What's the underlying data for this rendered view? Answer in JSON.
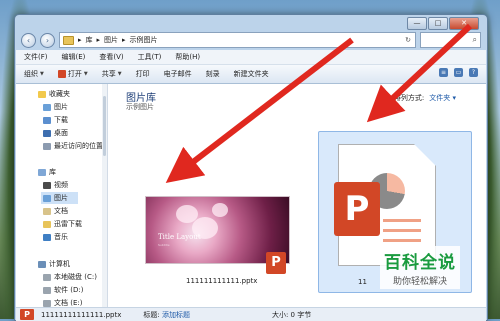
{
  "window": {
    "caption": {
      "minimize": "—",
      "maximize": "□",
      "close": "✕"
    }
  },
  "address": {
    "crumb1": "库",
    "crumb2": "图片",
    "crumb3": "示例图片",
    "refresh": "↻",
    "search_icon": "search-icon"
  },
  "menubar": {
    "items": [
      "文件(F)",
      "编辑(E)",
      "查看(V)",
      "工具(T)",
      "帮助(H)"
    ]
  },
  "toolbar": {
    "organize": "组织",
    "open": "打开",
    "share": "共享",
    "print": "打印",
    "email": "电子邮件",
    "burn": "刻录",
    "new_folder": "新建文件夹"
  },
  "sidebar": {
    "favorites": "收藏夹",
    "fav_items": [
      "图片",
      "下载",
      "桌面",
      "最近访问的位置"
    ],
    "libraries": "库",
    "lib_items": [
      "视频",
      "图片",
      "文档",
      "迅雷下载",
      "音乐"
    ],
    "computer": "计算机",
    "drives": [
      "本地磁盘 (C:)",
      "软件 (D:)",
      "文档 (E:)"
    ]
  },
  "content": {
    "title": "图片库",
    "subtitle": "示例图片",
    "arrange_label": "排列方式:",
    "arrange_value": "文件夹",
    "files": [
      {
        "name": "111111111111.pptx",
        "slide_title": "Title Layout",
        "slide_sub": "Subtitle"
      },
      {
        "name": "11",
        "icon": "P"
      }
    ]
  },
  "statusbar": {
    "filename": "11111111111111.pptx",
    "tags_label": "标题:",
    "tags_value": "添加标题",
    "size_label": "大小:",
    "size_value": "0 字节"
  },
  "watermark": {
    "title": "百科全说",
    "subtitle": "助你轻松解决"
  },
  "colors": {
    "accent": "#1e5aa8",
    "arrow": "#e0281f",
    "powerpoint": "#d24726",
    "watermark": "#1a9b3f"
  }
}
